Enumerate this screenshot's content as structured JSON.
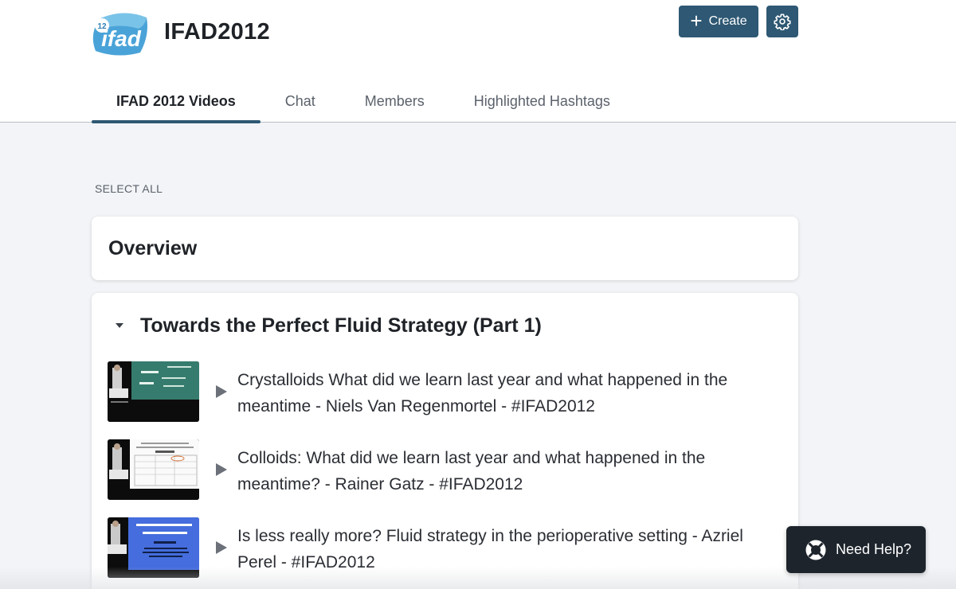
{
  "header": {
    "logo_badge": "12",
    "logo_text": "ifad",
    "group_title": "IFAD2012",
    "create_label": "Create"
  },
  "tabs": [
    {
      "label": "IFAD 2012 Videos",
      "active": true
    },
    {
      "label": "Chat",
      "active": false
    },
    {
      "label": "Members",
      "active": false
    },
    {
      "label": "Highlighted Hashtags",
      "active": false
    }
  ],
  "select_all_label": "SELECT ALL",
  "overview": {
    "title": "Overview"
  },
  "section": {
    "title": "Towards the Perfect Fluid Strategy (Part 1)",
    "expanded": true,
    "videos": [
      {
        "title": "Crystalloids What did we learn last year and what happened in the meantime - Niels Van Regenmortel - #IFAD2012",
        "thumb_theme": "green-board"
      },
      {
        "title": "Colloids: What did we learn last year and what happened in the meantime? - Rainer Gatz - #IFAD2012",
        "thumb_theme": "white-table-slide"
      },
      {
        "title": "Is less really more? Fluid strategy in the perioperative setting - Azriel Perel - #IFAD2012",
        "thumb_theme": "blue-slide"
      }
    ]
  },
  "help": {
    "label": "Need Help?"
  },
  "colors": {
    "primary": "#2e5873",
    "help_bg": "#1d242c",
    "page_bg": "#f2f4f7"
  },
  "icons": [
    "plus-icon",
    "gear-icon",
    "caret-down-icon",
    "play-icon",
    "lifebuoy-icon"
  ]
}
